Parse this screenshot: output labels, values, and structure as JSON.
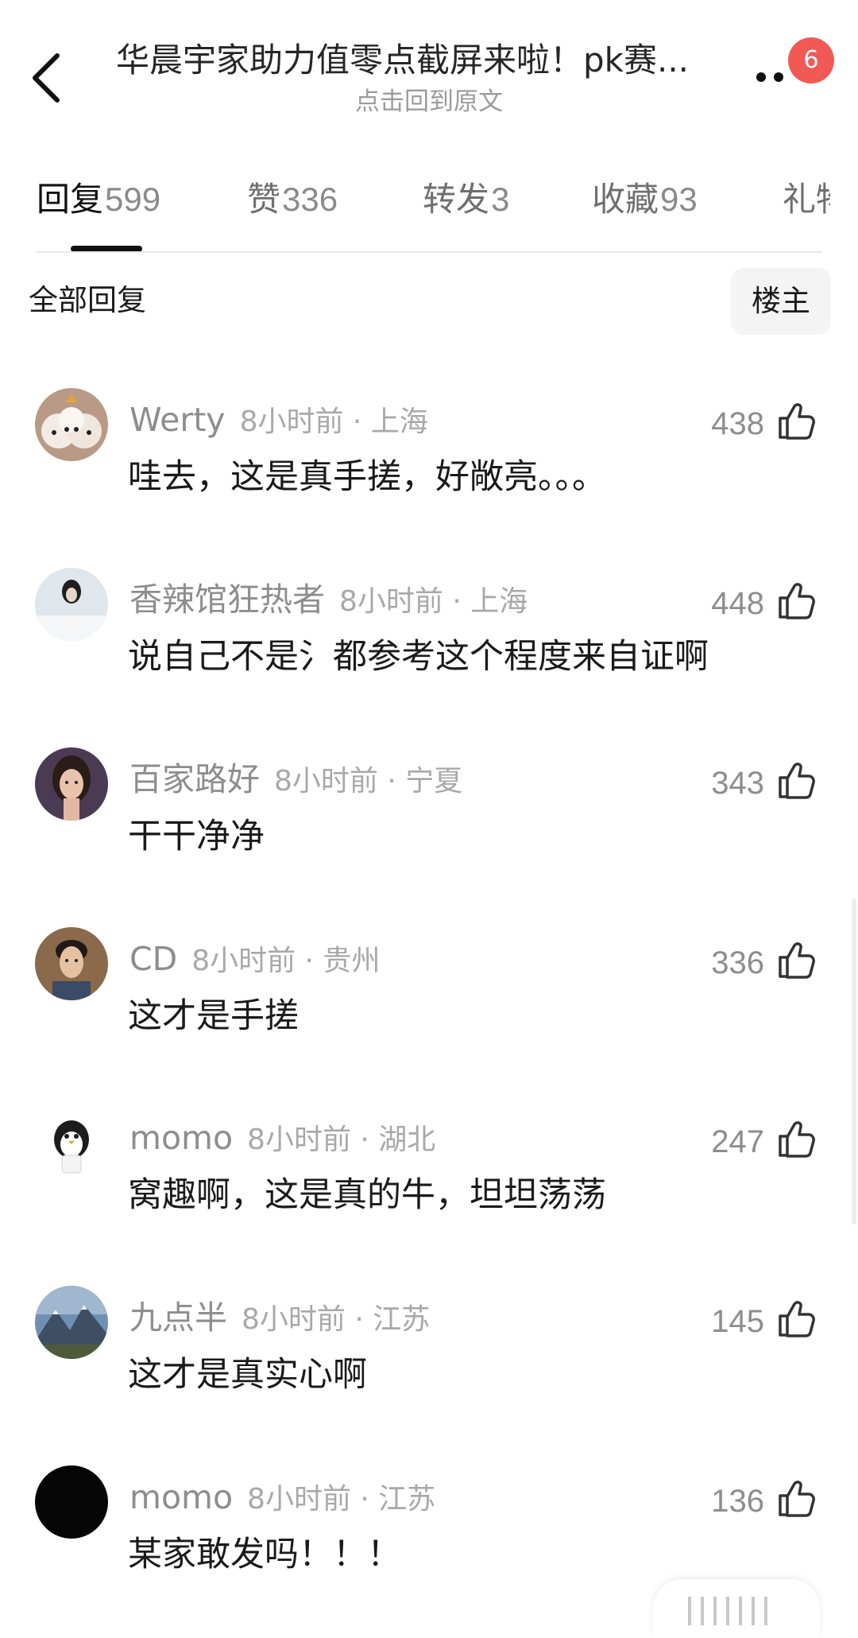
{
  "header": {
    "title": "华晨宇家助力值零点截屏来啦！pk赛...",
    "subtitle": "点击回到原文",
    "badge": "6"
  },
  "tabs": [
    {
      "label": "回复",
      "count": "599",
      "active": true
    },
    {
      "label": "赞",
      "count": "336"
    },
    {
      "label": "转发",
      "count": "3"
    },
    {
      "label": "收藏",
      "count": "93"
    },
    {
      "label": "礼物",
      "count": ""
    }
  ],
  "filter": {
    "label": "全部回复",
    "op_only": "楼主"
  },
  "comments": [
    {
      "name": "Werty",
      "time": "8小时前 · 上海",
      "text": "哇去，这是真手搓，好敞亮。。。",
      "likes": "438",
      "avatar": "dogs"
    },
    {
      "name": "香辣馆狂热者",
      "time": "8小时前 · 上海",
      "text": "说自己不是氵都参考这个程度来自证啊",
      "likes": "448",
      "avatar": "woman-snow"
    },
    {
      "name": "百家路好",
      "time": "8小时前 · 宁夏",
      "text": "干干净净",
      "likes": "343",
      "avatar": "woman-portrait"
    },
    {
      "name": "CD",
      "time": "8小时前 · 贵州",
      "text": "这才是手搓",
      "likes": "336",
      "avatar": "man-portrait"
    },
    {
      "name": "momo",
      "time": "8小时前 · 湖北",
      "text": "窝趣啊，这是真的牛，坦坦荡荡",
      "likes": "247",
      "avatar": "penguin"
    },
    {
      "name": "九点半",
      "time": "8小时前 · 江苏",
      "text": "这才是真实心啊",
      "likes": "145",
      "avatar": "mountains"
    },
    {
      "name": "momo",
      "time": "8小时前 · 江苏",
      "text": "某家敢发吗！！！",
      "likes": "136",
      "avatar": "black"
    }
  ]
}
